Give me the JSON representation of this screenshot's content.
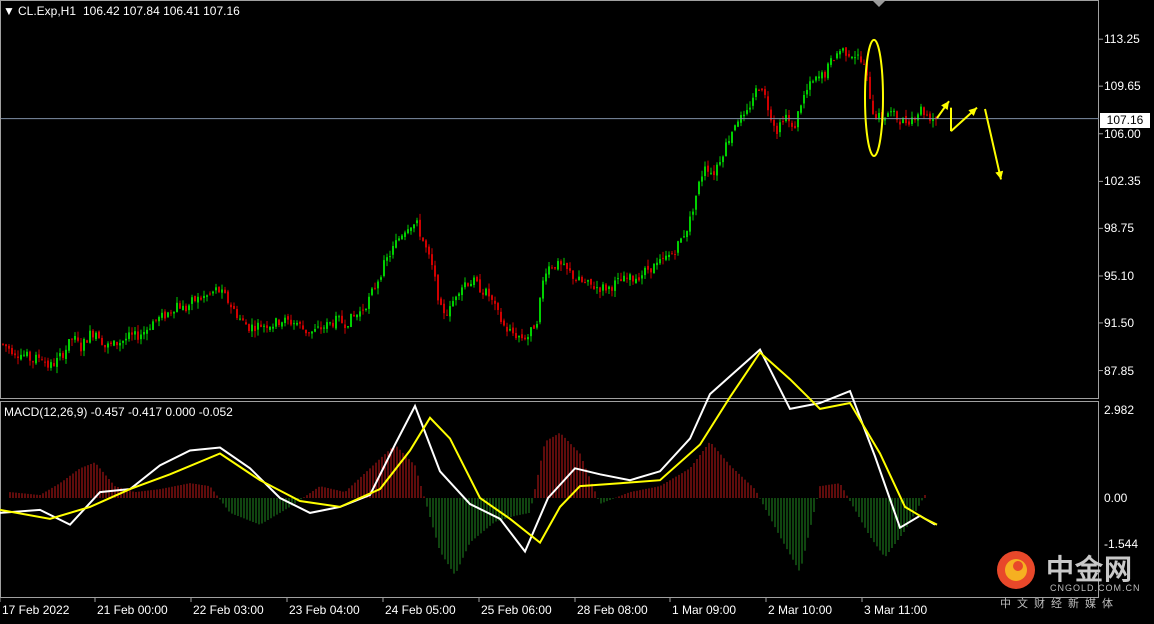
{
  "chart_header": {
    "menu_icon": "triangle-down-icon",
    "symbol_text": "CL.Exp,H1",
    "ohlc_text": "106.42 107.84 106.41 107.16"
  },
  "macd_header": {
    "text": "MACD(12,26,9) -0.457 -0.417 0.000 -0.052"
  },
  "current_price": "107.16",
  "colors": {
    "background": "#000000",
    "bull": "#00d000",
    "bear": "#d00000",
    "macd_line": "#ffffff",
    "signal_line": "#ffff00",
    "annotation": "#ffff00",
    "grid_border": "#a0a0a0"
  },
  "watermark": {
    "cn": "中金网",
    "en": "CNGOLD.COM.CN",
    "sub": "中文财经新媒体",
    "logo_icon": "cngold-logo-icon"
  },
  "chart_data": [
    {
      "type": "candlestick",
      "title": "CL.Exp,H1",
      "y_ticks": [
        "113.25",
        "109.65",
        "106.00",
        "102.35",
        "98.75",
        "95.10",
        "91.50",
        "87.85"
      ],
      "ylim": [
        85.9,
        116.1
      ],
      "x_ticks": [
        "17 Feb 2022",
        "21 Feb 00:00",
        "22 Feb 03:00",
        "23 Feb 04:00",
        "24 Feb 05:00",
        "25 Feb 06:00",
        "28 Feb 08:00",
        "1 Mar 09:00",
        "2 Mar 10:00",
        "3 Mar 11:00"
      ],
      "current_price": 107.16,
      "close_path": [
        [
          0,
          89.9
        ],
        [
          8,
          89.6
        ],
        [
          16,
          89.2
        ],
        [
          24,
          89.0
        ],
        [
          32,
          88.6
        ],
        [
          40,
          89.0
        ],
        [
          48,
          88.1
        ],
        [
          56,
          88.6
        ],
        [
          64,
          89.4
        ],
        [
          72,
          90.4
        ],
        [
          80,
          89.6
        ],
        [
          88,
          90.6
        ],
        [
          96,
          90.9
        ],
        [
          104,
          89.7
        ],
        [
          112,
          89.8
        ],
        [
          120,
          90.1
        ],
        [
          128,
          90.4
        ],
        [
          136,
          90.5
        ],
        [
          144,
          90.9
        ],
        [
          152,
          91.6
        ],
        [
          160,
          91.9
        ],
        [
          168,
          92.3
        ],
        [
          176,
          93.0
        ],
        [
          184,
          92.5
        ],
        [
          192,
          93.2
        ],
        [
          200,
          93.4
        ],
        [
          208,
          93.6
        ],
        [
          216,
          94.1
        ],
        [
          224,
          93.5
        ],
        [
          232,
          92.6
        ],
        [
          240,
          91.7
        ],
        [
          248,
          91.2
        ],
        [
          256,
          91.3
        ],
        [
          264,
          91.4
        ],
        [
          272,
          91.4
        ],
        [
          280,
          91.7
        ],
        [
          288,
          91.6
        ],
        [
          296,
          91.5
        ],
        [
          304,
          90.9
        ],
        [
          312,
          90.8
        ],
        [
          320,
          91.1
        ],
        [
          328,
          91.4
        ],
        [
          336,
          91.7
        ],
        [
          344,
          91.5
        ],
        [
          352,
          91.9
        ],
        [
          360,
          92.4
        ],
        [
          368,
          93.3
        ],
        [
          376,
          94.7
        ],
        [
          384,
          96.1
        ],
        [
          392,
          97.2
        ],
        [
          400,
          98.3
        ],
        [
          408,
          99.1
        ],
        [
          416,
          99.0
        ],
        [
          424,
          97.4
        ],
        [
          432,
          95.5
        ],
        [
          440,
          92.5
        ],
        [
          448,
          92.3
        ],
        [
          456,
          94.0
        ],
        [
          464,
          94.6
        ],
        [
          472,
          94.7
        ],
        [
          480,
          94.1
        ],
        [
          488,
          93.6
        ],
        [
          496,
          92.3
        ],
        [
          504,
          91.1
        ],
        [
          512,
          90.7
        ],
        [
          520,
          90.4
        ],
        [
          528,
          90.5
        ],
        [
          536,
          91.8
        ],
        [
          544,
          95.6
        ],
        [
          552,
          96.0
        ],
        [
          560,
          95.8
        ],
        [
          568,
          95.4
        ],
        [
          576,
          94.8
        ],
        [
          584,
          94.5
        ],
        [
          592,
          94.3
        ],
        [
          600,
          94.2
        ],
        [
          608,
          94.2
        ],
        [
          616,
          94.6
        ],
        [
          624,
          94.8
        ],
        [
          632,
          94.9
        ],
        [
          640,
          95.2
        ],
        [
          648,
          95.7
        ],
        [
          656,
          95.9
        ],
        [
          664,
          96.4
        ],
        [
          672,
          96.9
        ],
        [
          680,
          97.9
        ],
        [
          688,
          99.1
        ],
        [
          696,
          101.6
        ],
        [
          704,
          103.7
        ],
        [
          712,
          102.9
        ],
        [
          720,
          104.3
        ],
        [
          728,
          105.7
        ],
        [
          736,
          107.2
        ],
        [
          744,
          107.1
        ],
        [
          752,
          108.9
        ],
        [
          760,
          109.9
        ],
        [
          768,
          107.8
        ],
        [
          776,
          106.3
        ],
        [
          784,
          107.6
        ],
        [
          792,
          106.1
        ],
        [
          800,
          108.4
        ],
        [
          808,
          109.6
        ],
        [
          816,
          110.2
        ],
        [
          824,
          110.6
        ],
        [
          832,
          111.8
        ],
        [
          840,
          112.5
        ],
        [
          848,
          112.2
        ],
        [
          856,
          112.0
        ],
        [
          864,
          111.0
        ],
        [
          872,
          107.7
        ],
        [
          880,
          107.1
        ],
        [
          888,
          107.7
        ],
        [
          896,
          107.2
        ],
        [
          904,
          106.9
        ],
        [
          912,
          107.3
        ],
        [
          920,
          107.9
        ],
        [
          928,
          107.3
        ],
        [
          936,
          107.2
        ]
      ],
      "annotation": {
        "ellipse_at": {
          "bar_index": 874,
          "price_top": 113.2,
          "price_bottom": 104.3
        },
        "arrows": [
          {
            "from": [
              937,
              107.2
            ],
            "to": [
              949,
              108.5
            ]
          },
          {
            "from": [
              951,
              108.0
            ],
            "to": [
              951,
              106.2
            ]
          },
          {
            "from": [
              951,
              106.2
            ],
            "to": [
              977,
              108.0
            ]
          },
          {
            "from": [
              985,
              107.9
            ],
            "to": [
              1001,
              102.5
            ]
          }
        ]
      }
    },
    {
      "type": "macd",
      "title": "MACD(12,26,9) -0.457 -0.417 0.000 -0.052",
      "y_ticks": [
        "2.982",
        "0.00",
        "-1.544"
      ],
      "ylim": [
        -3.3,
        3.2
      ],
      "params": [
        12,
        26,
        9
      ],
      "values": {
        "macd": -0.457,
        "signal": -0.417,
        "level": 0.0,
        "histogram": -0.052
      },
      "series": [
        {
          "name": "MACD",
          "color": "#ffffff",
          "points": [
            [
              0,
              -0.5
            ],
            [
              40,
              -0.4
            ],
            [
              70,
              -0.9
            ],
            [
              100,
              0.2
            ],
            [
              130,
              0.3
            ],
            [
              160,
              1.1
            ],
            [
              190,
              1.6
            ],
            [
              220,
              1.7
            ],
            [
              250,
              1.0
            ],
            [
              280,
              0.0
            ],
            [
              310,
              -0.5
            ],
            [
              340,
              -0.3
            ],
            [
              370,
              0.1
            ],
            [
              395,
              1.8
            ],
            [
              415,
              3.1
            ],
            [
              440,
              0.9
            ],
            [
              470,
              -0.2
            ],
            [
              500,
              -0.7
            ],
            [
              525,
              -1.8
            ],
            [
              548,
              0.0
            ],
            [
              575,
              1.0
            ],
            [
              600,
              0.8
            ],
            [
              630,
              0.6
            ],
            [
              660,
              0.9
            ],
            [
              690,
              2.0
            ],
            [
              710,
              3.5
            ],
            [
              730,
              4.1
            ],
            [
              760,
              5.0
            ],
            [
              790,
              3.0
            ],
            [
              820,
              3.2
            ],
            [
              850,
              3.6
            ],
            [
              875,
              1.4
            ],
            [
              900,
              -1.0
            ],
            [
              920,
              -0.6
            ],
            [
              935,
              -0.9
            ]
          ]
        },
        {
          "name": "Signal",
          "color": "#ffff00",
          "points": [
            [
              0,
              -0.4
            ],
            [
              50,
              -0.7
            ],
            [
              90,
              -0.3
            ],
            [
              130,
              0.3
            ],
            [
              170,
              0.8
            ],
            [
              220,
              1.5
            ],
            [
              260,
              0.6
            ],
            [
              300,
              -0.1
            ],
            [
              340,
              -0.3
            ],
            [
              380,
              0.3
            ],
            [
              410,
              1.6
            ],
            [
              430,
              2.7
            ],
            [
              450,
              2.0
            ],
            [
              480,
              0.0
            ],
            [
              510,
              -0.7
            ],
            [
              540,
              -1.5
            ],
            [
              560,
              -0.3
            ],
            [
              580,
              0.4
            ],
            [
              620,
              0.5
            ],
            [
              660,
              0.6
            ],
            [
              700,
              1.8
            ],
            [
              730,
              3.4
            ],
            [
              760,
              4.9
            ],
            [
              790,
              4.0
            ],
            [
              820,
              3.0
            ],
            [
              850,
              3.2
            ],
            [
              880,
              1.5
            ],
            [
              905,
              -0.3
            ],
            [
              925,
              -0.7
            ],
            [
              937,
              -0.9
            ]
          ]
        }
      ],
      "histogram": [
        [
          10,
          0.2
        ],
        [
          40,
          0.1
        ],
        [
          60,
          0.5
        ],
        [
          80,
          1.0
        ],
        [
          95,
          1.2
        ],
        [
          115,
          0.4
        ],
        [
          135,
          0.2
        ],
        [
          160,
          0.3
        ],
        [
          190,
          0.5
        ],
        [
          210,
          0.4
        ],
        [
          230,
          -0.5
        ],
        [
          260,
          -0.9
        ],
        [
          290,
          -0.3
        ],
        [
          320,
          0.4
        ],
        [
          345,
          0.2
        ],
        [
          370,
          1.0
        ],
        [
          395,
          1.8
        ],
        [
          415,
          1.1
        ],
        [
          440,
          -1.8
        ],
        [
          455,
          -2.6
        ],
        [
          470,
          -1.5
        ],
        [
          495,
          -0.8
        ],
        [
          515,
          -0.6
        ],
        [
          530,
          -0.5
        ],
        [
          545,
          1.9
        ],
        [
          560,
          2.2
        ],
        [
          580,
          1.5
        ],
        [
          600,
          -0.2
        ],
        [
          630,
          0.2
        ],
        [
          660,
          0.4
        ],
        [
          690,
          1.0
        ],
        [
          710,
          1.9
        ],
        [
          730,
          1.1
        ],
        [
          755,
          0.3
        ],
        [
          780,
          -1.3
        ],
        [
          800,
          -2.5
        ],
        [
          820,
          0.4
        ],
        [
          840,
          0.5
        ],
        [
          870,
          -1.3
        ],
        [
          885,
          -2.0
        ],
        [
          905,
          -1.1
        ],
        [
          925,
          0.1
        ]
      ]
    }
  ]
}
